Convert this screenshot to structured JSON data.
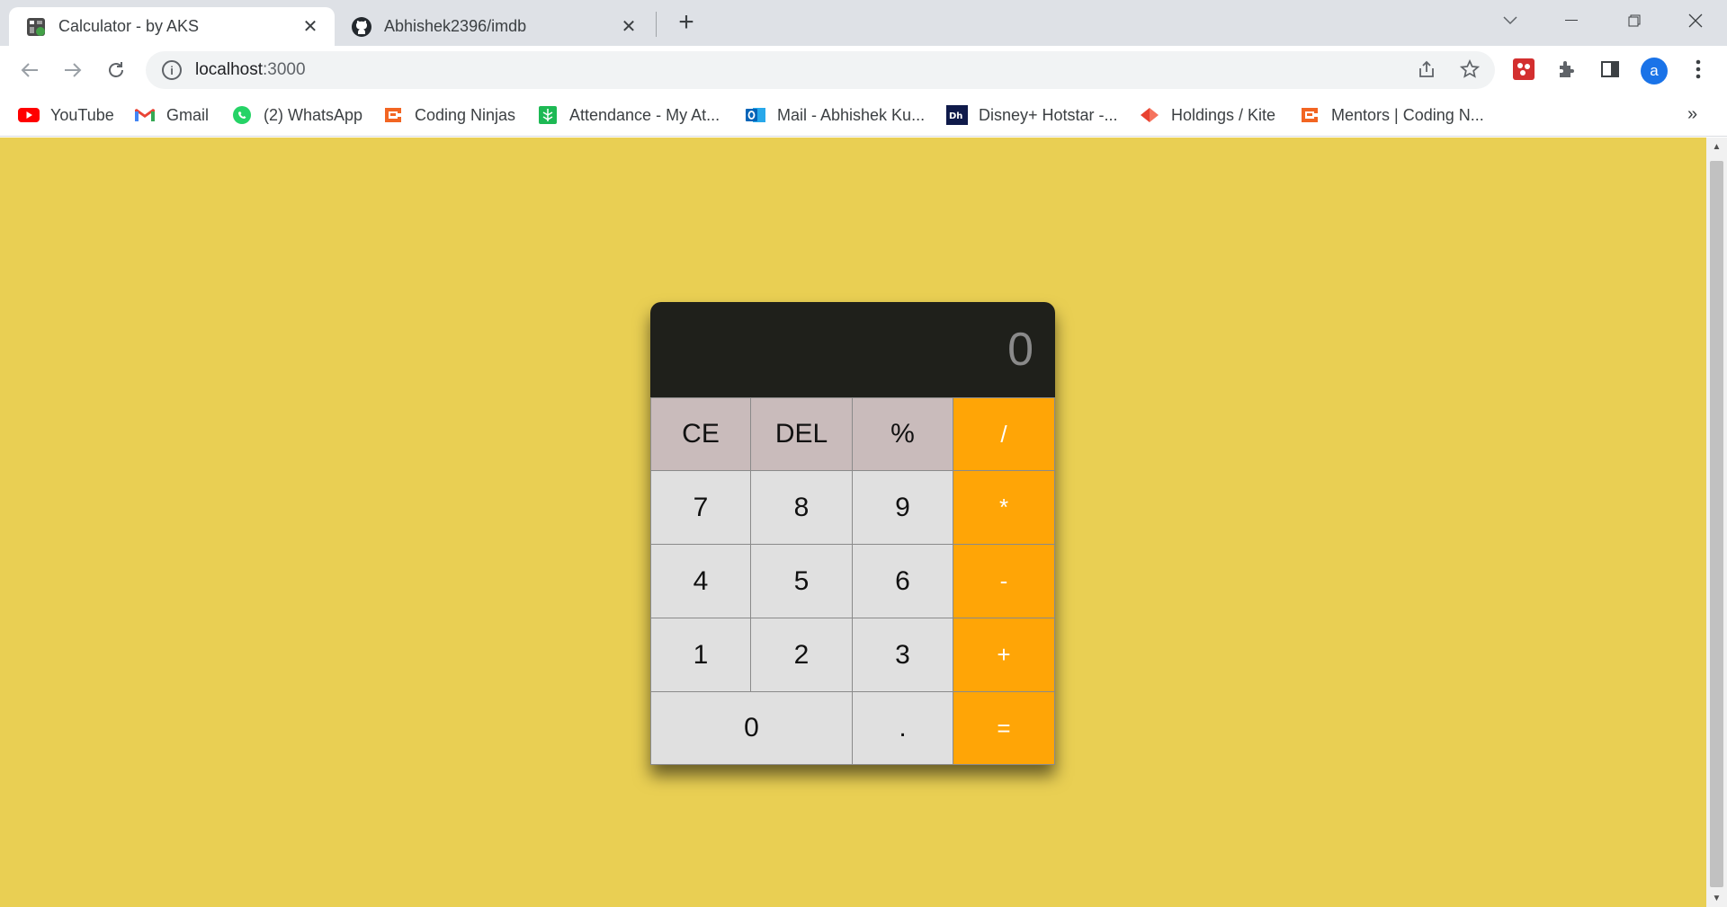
{
  "browser": {
    "tabs": [
      {
        "title": "Calculator - by AKS",
        "active": true,
        "icon": "calculator-favicon"
      },
      {
        "title": "Abhishek2396/imdb",
        "active": false,
        "icon": "github-favicon"
      }
    ],
    "new_tab_label": "+",
    "url_host": "localhost",
    "url_port": ":3000",
    "bookmarks": [
      {
        "label": "YouTube",
        "icon": "youtube-icon"
      },
      {
        "label": "Gmail",
        "icon": "gmail-icon"
      },
      {
        "label": "(2) WhatsApp",
        "icon": "whatsapp-icon"
      },
      {
        "label": "Coding Ninjas",
        "icon": "coding-ninjas-icon"
      },
      {
        "label": "Attendance - My At...",
        "icon": "attendance-icon"
      },
      {
        "label": "Mail - Abhishek Ku...",
        "icon": "outlook-icon"
      },
      {
        "label": "Disney+ Hotstar -...",
        "icon": "hotstar-icon"
      },
      {
        "label": "Holdings / Kite",
        "icon": "kite-icon"
      },
      {
        "label": "Mentors | Coding N...",
        "icon": "coding-ninjas-icon"
      }
    ],
    "profile_initial": "a",
    "bookmarks_overflow": "»"
  },
  "calculator": {
    "display_value": "0",
    "keys": {
      "ce": "CE",
      "del": "DEL",
      "percent": "%",
      "divide": "/",
      "seven": "7",
      "eight": "8",
      "nine": "9",
      "multiply": "*",
      "four": "4",
      "five": "5",
      "six": "6",
      "subtract": "-",
      "one": "1",
      "two": "2",
      "three": "3",
      "add": "+",
      "zero": "0",
      "decimal": ".",
      "equals": "="
    },
    "colors": {
      "page_bg": "#e9cf53",
      "display_bg": "#1f201b",
      "function_key": "#c9bbbb",
      "digit_key": "#e0e0e0",
      "operator_key": "#ffa506"
    }
  }
}
